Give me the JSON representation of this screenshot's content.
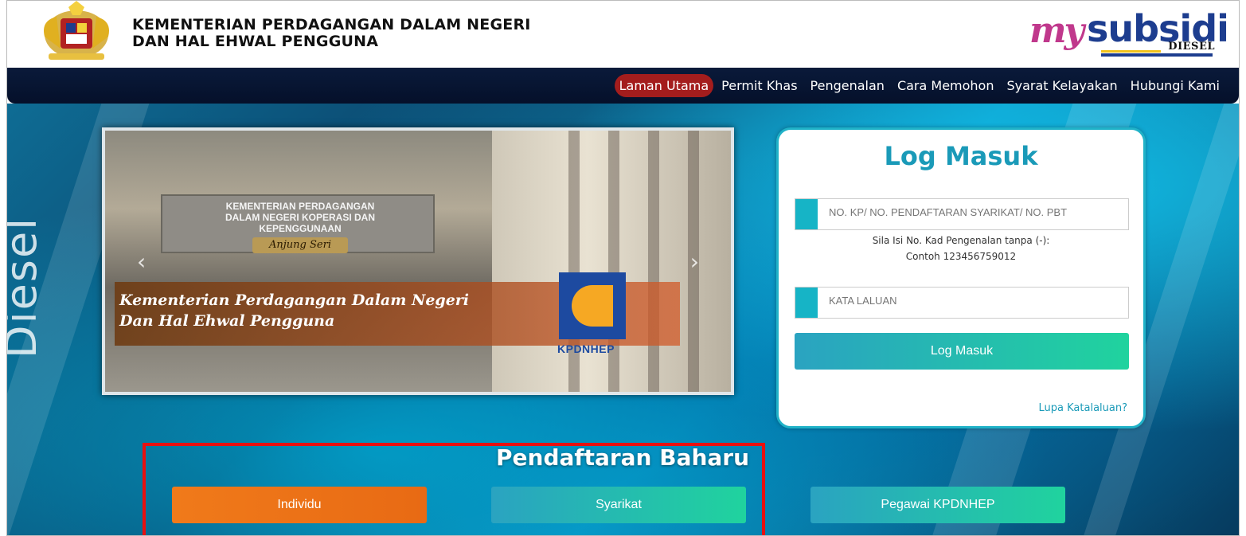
{
  "header": {
    "ministry_line1": "KEMENTERIAN PERDAGANGAN DALAM NEGERI",
    "ministry_line2": "DAN HAL EHWAL PENGGUNA",
    "brand_my": "my",
    "brand_subsidi": "subsidi",
    "brand_diesel": "DIESEL"
  },
  "nav": {
    "items": [
      {
        "label": "Laman Utama",
        "active": true
      },
      {
        "label": "Permit Khas"
      },
      {
        "label": "Pengenalan"
      },
      {
        "label": "Cara Memohon"
      },
      {
        "label": "Syarat Kelayakan"
      },
      {
        "label": "Hubungi Kami"
      }
    ]
  },
  "hero": {
    "bg_word": "Diesel"
  },
  "slider": {
    "caption_line1": "Kementerian Perdagangan Dalam Negeri",
    "caption_line2": "Dan Hal Ehwal Pengguna",
    "sign_text": "KEMENTERIAN PERDAGANGAN DALAM NEGERI KOPERASI DAN KEPENGGUNAAN",
    "sign_plaque": "Anjung Seri",
    "logo_label": "KPDNHEP"
  },
  "login": {
    "title": "Log Masuk",
    "id_placeholder": "NO. KP/ NO. PENDAFTARAN SYARIKAT/ NO. PBT",
    "hint_line1": "Sila Isi No. Kad Pengenalan tanpa (-):",
    "hint_line2": "Contoh 123456759012",
    "password_placeholder": "KATA LALUAN",
    "submit_label": "Log Masuk",
    "forgot_label": "Lupa Katalaluan?"
  },
  "registration": {
    "title": "Pendaftaran Baharu",
    "individu": "Individu",
    "syarikat": "Syarikat",
    "pegawai": "Pegawai KPDNHEP"
  },
  "colors": {
    "accent": "#1a9ab8",
    "nav_active": "#a41d1d",
    "highlight_box": "#e81010"
  }
}
